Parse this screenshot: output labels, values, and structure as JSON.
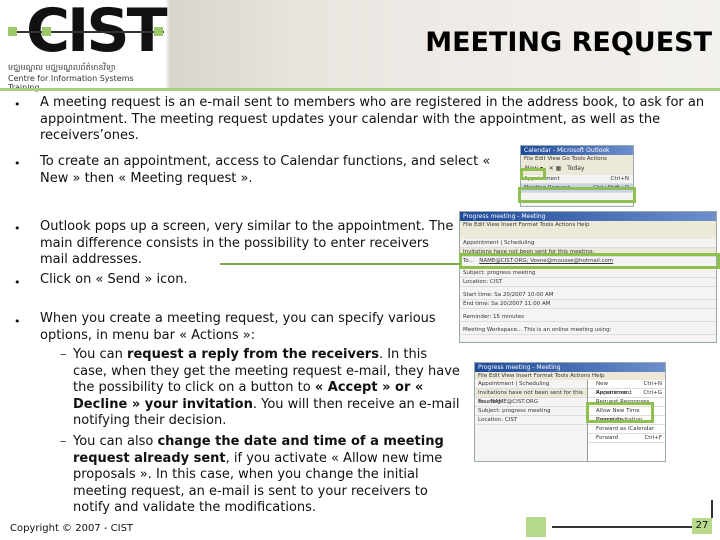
{
  "header": {
    "logo_text": "CIST",
    "logo_khmer": "មជ្ឈមណ្ឌល  មជ្ឈមណ្ឌលព័ត៌មានវិទ្យា",
    "logo_subtitle": "Centre for Information Systems Training",
    "title": "MEETING REQUEST"
  },
  "bullets": [
    "A meeting request is an e-mail sent to members who are registered in the address book, to ask for an appointment. The meeting request updates your calendar with the appointment, as well as the receivers’ones.",
    "To create an appointment, access to Calendar functions, and select « New » then « Meeting request ».",
    "Outlook pops up a screen, very similar to the appointment. The main difference consists in the possibility to enter receivers mail addresses.",
    "Click on « Send » icon.",
    "When you create a meeting request, you can specify various options, in menu bar « Actions »:"
  ],
  "subbullets": [
    {
      "parts": [
        [
          "You can ",
          false
        ],
        [
          "request a reply from the receivers",
          true
        ],
        [
          ". In this case, when they get the meeting request e-mail, they have the possibility to click on a button to ",
          false
        ],
        [
          "« Accept » or « Decline » your invitation",
          true
        ],
        [
          ". You will then receive an e-mail notifying their decision.",
          false
        ]
      ]
    },
    {
      "parts": [
        [
          "You can also ",
          false
        ],
        [
          "change the date and time of a meeting request already sent",
          true
        ],
        [
          ", if you activate « Allow new time proposals ». In this case, when you change the initial meeting request, an e-mail is sent to your receivers to notify and validate the modifications.",
          false
        ]
      ]
    }
  ],
  "screenshot1": {
    "title": "Calendar - Microsoft Outlook",
    "menu": "File  Edit  View  Go  Tools  Actions",
    "new": "New",
    "today": "Today",
    "items": [
      [
        "Appointment",
        "Ctrl+N"
      ],
      [
        "Meeting Request",
        "Ctrl+Shift+Q"
      ]
    ]
  },
  "screenshot2": {
    "title": "Progress meeting - Meeting",
    "menu": "File  Edit  View  Insert  Format  Tools  Actions  Help",
    "tabs": "Appointment | Scheduling",
    "info": "Invitations have not been sent for this meeting.",
    "to": "To...",
    "to_value": "NAME@CIST.ORG; Vosne@mousse@hotmail.com",
    "rows": [
      "Subject:  progress meeting",
      "Location:  CIST",
      "Start time:  Sa 20/2007   10:00 AM",
      "End time:  Sa 20/2007   11:00 AM",
      "Reminder:  15 minutes",
      "Meeting Workspace...  This is an online meeting using:"
    ]
  },
  "screenshot3": {
    "title": "Progress meeting - Meeting",
    "menu": "File  Edit  View  Insert  Format  Tools  Actions  Help",
    "left_rows": [
      "Appointment | Scheduling",
      "Invitations have not been sent for this meeting.",
      "To...  NAME@CIST.ORG",
      "Subject:  progress meeting",
      "Location:  CIST"
    ],
    "actions": [
      [
        "New Appointment",
        "Ctrl+N"
      ],
      [
        "Recurrence...",
        "Ctrl+G"
      ],
      [
        "Request Responses",
        ""
      ],
      [
        "Allow New Time Proposals",
        ""
      ],
      [
        "Cancel Invitation",
        ""
      ],
      [
        "Forward as iCalendar",
        ""
      ],
      [
        "Forward",
        "Ctrl+F"
      ]
    ]
  },
  "footer": {
    "copyright": "Copyright © 2007 - CIST",
    "page": "27"
  },
  "colors": {
    "accent": "#8fc04f",
    "rule": "#a9cf7f"
  }
}
